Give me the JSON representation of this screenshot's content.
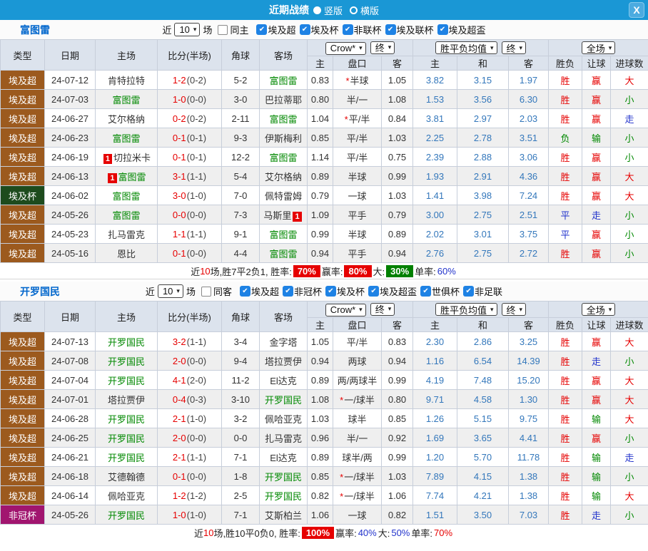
{
  "title_bar": {
    "title": "近期战绩",
    "radio_vertical": "竖版",
    "radio_horizontal": "横版",
    "close_label": "X"
  },
  "filter": {
    "near": "近",
    "count": "10",
    "games": "场"
  },
  "header": {
    "type": "类型",
    "date": "日期",
    "home": "主场",
    "score": "比分(半场)",
    "corner": "角球",
    "away": "客场",
    "odds_company": "Crow*",
    "odds_time": "终",
    "mean_type": "胜平负均值",
    "mean_time": "终",
    "scope": "全场",
    "sub_home": "主",
    "sub_handicap": "盘口",
    "sub_away": "客",
    "sub_mean_home": "主",
    "sub_mean_draw": "和",
    "sub_mean_away": "客",
    "sub_result": "胜负",
    "sub_let": "让球",
    "sub_goals": "进球数"
  },
  "colors": {
    "titlebar_blue": "#1A97D5",
    "team_green": "#008800",
    "mean_blue": "#3377BB",
    "type_bg": {
      "埃及超": "#9C5A1E",
      "埃及杯": "#1D4B1D",
      "非冠杯": "#A1156F"
    },
    "result": {
      "胜": "#E60000",
      "赢": "#E60000",
      "大": "#E60000",
      "平": "#2233CC",
      "走": "#2233CC",
      "负": "#008800",
      "输": "#008800",
      "小": "#008800"
    }
  },
  "sections": [
    {
      "team": "富图雷",
      "same_label": "同主",
      "leagues": [
        "埃及超",
        "埃及杯",
        "非联杯",
        "埃及联杯",
        "埃及超盃"
      ],
      "rows": [
        {
          "type": "埃及超",
          "date": "24-07-12",
          "home": "肯特拉特",
          "home_green": false,
          "score": "1-2",
          "half": "(0-2)",
          "corner": "5-2",
          "away": "富图雷",
          "away_green": true,
          "home_odds": "0.83",
          "star": true,
          "handicap": "半球",
          "away_odds": "1.05",
          "mean_home": "3.82",
          "mean_draw": "3.15",
          "mean_away": "1.97",
          "outcome": "胜",
          "let_outcome": "赢",
          "goals_outcome": "大"
        },
        {
          "type": "埃及超",
          "date": "24-07-03",
          "home": "富图雷",
          "home_green": true,
          "score": "1-0",
          "half": "(0-0)",
          "corner": "3-0",
          "away": "巴拉蒂耶",
          "away_green": false,
          "home_odds": "0.80",
          "star": false,
          "handicap": "半/一",
          "away_odds": "1.08",
          "mean_home": "1.53",
          "mean_draw": "3.56",
          "mean_away": "6.30",
          "outcome": "胜",
          "let_outcome": "赢",
          "goals_outcome": "小"
        },
        {
          "type": "埃及超",
          "date": "24-06-27",
          "home": "艾尔格纳",
          "home_green": false,
          "score": "0-2",
          "half": "(0-2)",
          "corner": "2-11",
          "away": "富图雷",
          "away_green": true,
          "home_odds": "1.04",
          "star": true,
          "handicap": "平/半",
          "away_odds": "0.84",
          "mean_home": "3.81",
          "mean_draw": "2.97",
          "mean_away": "2.03",
          "outcome": "胜",
          "let_outcome": "赢",
          "goals_outcome": "走"
        },
        {
          "type": "埃及超",
          "date": "24-06-23",
          "home": "富图雷",
          "home_green": true,
          "score": "0-1",
          "half": "(0-1)",
          "corner": "9-3",
          "away": "伊斯梅利",
          "away_green": false,
          "home_odds": "0.85",
          "star": false,
          "handicap": "平/半",
          "away_odds": "1.03",
          "mean_home": "2.25",
          "mean_draw": "2.78",
          "mean_away": "3.51",
          "outcome": "负",
          "let_outcome": "输",
          "goals_outcome": "小"
        },
        {
          "type": "埃及超",
          "date": "24-06-19",
          "home": "切拉米卡",
          "home_green": false,
          "home_badge": "1",
          "score": "0-1",
          "half": "(0-1)",
          "corner": "12-2",
          "away": "富图雷",
          "away_green": true,
          "home_odds": "1.14",
          "star": false,
          "handicap": "平/半",
          "away_odds": "0.75",
          "mean_home": "2.39",
          "mean_draw": "2.88",
          "mean_away": "3.06",
          "outcome": "胜",
          "let_outcome": "赢",
          "goals_outcome": "小"
        },
        {
          "type": "埃及超",
          "date": "24-06-13",
          "home": "富图雷",
          "home_green": true,
          "home_badge": "1",
          "score": "3-1",
          "half": "(1-1)",
          "corner": "5-4",
          "away": "艾尔格纳",
          "away_green": false,
          "home_odds": "0.89",
          "star": false,
          "handicap": "半球",
          "away_odds": "0.99",
          "mean_home": "1.93",
          "mean_draw": "2.91",
          "mean_away": "4.36",
          "outcome": "胜",
          "let_outcome": "赢",
          "goals_outcome": "大"
        },
        {
          "type": "埃及杯",
          "date": "24-06-02",
          "home": "富图雷",
          "home_green": true,
          "score": "3-0",
          "half": "(1-0)",
          "corner": "7-0",
          "away": "佩特雷姆",
          "away_green": false,
          "home_odds": "0.79",
          "star": false,
          "handicap": "一球",
          "away_odds": "1.03",
          "mean_home": "1.41",
          "mean_draw": "3.98",
          "mean_away": "7.24",
          "outcome": "胜",
          "let_outcome": "赢",
          "goals_outcome": "大"
        },
        {
          "type": "埃及超",
          "date": "24-05-26",
          "home": "富图雷",
          "home_green": true,
          "score": "0-0",
          "half": "(0-0)",
          "corner": "7-3",
          "away": "马斯里",
          "away_green": false,
          "away_badge": "1",
          "away_badge_after": true,
          "home_odds": "1.09",
          "star": false,
          "handicap": "平手",
          "away_odds": "0.79",
          "mean_home": "3.00",
          "mean_draw": "2.75",
          "mean_away": "2.51",
          "outcome": "平",
          "let_outcome": "走",
          "goals_outcome": "小"
        },
        {
          "type": "埃及超",
          "date": "24-05-23",
          "home": "扎马雷克",
          "home_green": false,
          "score": "1-1",
          "half": "(1-1)",
          "corner": "9-1",
          "away": "富图雷",
          "away_green": true,
          "home_odds": "0.99",
          "star": false,
          "handicap": "半球",
          "away_odds": "0.89",
          "mean_home": "2.02",
          "mean_draw": "3.01",
          "mean_away": "3.75",
          "outcome": "平",
          "let_outcome": "赢",
          "goals_outcome": "小"
        },
        {
          "type": "埃及超",
          "date": "24-05-16",
          "home": "恩比",
          "home_green": false,
          "score": "0-1",
          "half": "(0-0)",
          "corner": "4-4",
          "away": "富图雷",
          "away_green": true,
          "home_odds": "0.94",
          "star": false,
          "handicap": "平手",
          "away_odds": "0.94",
          "mean_home": "2.76",
          "mean_draw": "2.75",
          "mean_away": "2.72",
          "outcome": "胜",
          "let_outcome": "赢",
          "goals_outcome": "小"
        }
      ],
      "summary": {
        "near": "近",
        "count": "10",
        "text": "场,胜7平2负1, 胜率:",
        "win_rate": "70%",
        "win_class": "pct badge-red",
        "handicap_label": "赢率:",
        "handicap_rate": "80%",
        "handicap_class": "pct badge-red",
        "big_label": "大:",
        "big_rate": "30%",
        "big_class": "pct badge-green",
        "single_label": "单率:",
        "single_rate": "60%",
        "single_class": "pct text-blue"
      }
    },
    {
      "team": "开罗国民",
      "same_label": "同客",
      "leagues": [
        "埃及超",
        "非冠杯",
        "埃及杯",
        "埃及超盃",
        "世俱杯",
        "非足联"
      ],
      "rows": [
        {
          "type": "埃及超",
          "date": "24-07-13",
          "home": "开罗国民",
          "home_green": true,
          "score": "3-2",
          "half": "(1-1)",
          "corner": "3-4",
          "away": "金字塔",
          "away_green": false,
          "home_odds": "1.05",
          "star": false,
          "handicap": "平/半",
          "away_odds": "0.83",
          "mean_home": "2.30",
          "mean_draw": "2.86",
          "mean_away": "3.25",
          "outcome": "胜",
          "let_outcome": "赢",
          "goals_outcome": "大"
        },
        {
          "type": "埃及超",
          "date": "24-07-08",
          "home": "开罗国民",
          "home_green": true,
          "score": "2-0",
          "half": "(0-0)",
          "corner": "9-4",
          "away": "塔拉贾伊",
          "away_green": false,
          "home_odds": "0.94",
          "star": false,
          "handicap": "两球",
          "away_odds": "0.94",
          "mean_home": "1.16",
          "mean_draw": "6.54",
          "mean_away": "14.39",
          "outcome": "胜",
          "let_outcome": "走",
          "goals_outcome": "小"
        },
        {
          "type": "埃及超",
          "date": "24-07-04",
          "home": "开罗国民",
          "home_green": true,
          "score": "4-1",
          "half": "(2-0)",
          "corner": "11-2",
          "away": "El达克",
          "away_green": false,
          "home_odds": "0.89",
          "star": false,
          "handicap": "两/两球半",
          "away_odds": "0.99",
          "mean_home": "4.19",
          "mean_draw": "7.48",
          "mean_away": "15.20",
          "outcome": "胜",
          "let_outcome": "赢",
          "goals_outcome": "大"
        },
        {
          "type": "埃及超",
          "date": "24-07-01",
          "home": "塔拉贾伊",
          "home_green": false,
          "score": "0-4",
          "half": "(0-3)",
          "corner": "3-10",
          "away": "开罗国民",
          "away_green": true,
          "home_odds": "1.08",
          "star": true,
          "handicap": "一/球半",
          "away_odds": "0.80",
          "mean_home": "9.71",
          "mean_draw": "4.58",
          "mean_away": "1.30",
          "outcome": "胜",
          "let_outcome": "赢",
          "goals_outcome": "大"
        },
        {
          "type": "埃及超",
          "date": "24-06-28",
          "home": "开罗国民",
          "home_green": true,
          "score": "2-1",
          "half": "(1-0)",
          "corner": "3-2",
          "away": "佩哈亚克",
          "away_green": false,
          "home_odds": "1.03",
          "star": false,
          "handicap": "球半",
          "away_odds": "0.85",
          "mean_home": "1.26",
          "mean_draw": "5.15",
          "mean_away": "9.75",
          "outcome": "胜",
          "let_outcome": "输",
          "goals_outcome": "大"
        },
        {
          "type": "埃及超",
          "date": "24-06-25",
          "home": "开罗国民",
          "home_green": true,
          "score": "2-0",
          "half": "(0-0)",
          "corner": "0-0",
          "away": "扎马雷克",
          "away_green": false,
          "home_odds": "0.96",
          "star": false,
          "handicap": "半/一",
          "away_odds": "0.92",
          "mean_home": "1.69",
          "mean_draw": "3.65",
          "mean_away": "4.41",
          "outcome": "胜",
          "let_outcome": "赢",
          "goals_outcome": "小"
        },
        {
          "type": "埃及超",
          "date": "24-06-21",
          "home": "开罗国民",
          "home_green": true,
          "score": "2-1",
          "half": "(1-1)",
          "corner": "7-1",
          "away": "El达克",
          "away_green": false,
          "home_odds": "0.89",
          "star": false,
          "handicap": "球半/两",
          "away_odds": "0.99",
          "mean_home": "1.20",
          "mean_draw": "5.70",
          "mean_away": "11.78",
          "outcome": "胜",
          "let_outcome": "输",
          "goals_outcome": "走"
        },
        {
          "type": "埃及超",
          "date": "24-06-18",
          "home": "艾德翰德",
          "home_green": false,
          "score": "0-1",
          "half": "(0-0)",
          "corner": "1-8",
          "away": "开罗国民",
          "away_green": true,
          "home_odds": "0.85",
          "star": true,
          "handicap": "一/球半",
          "away_odds": "1.03",
          "mean_home": "7.89",
          "mean_draw": "4.15",
          "mean_away": "1.38",
          "outcome": "胜",
          "let_outcome": "输",
          "goals_outcome": "小"
        },
        {
          "type": "埃及超",
          "date": "24-06-14",
          "home": "佩哈亚克",
          "home_green": false,
          "score": "1-2",
          "half": "(1-2)",
          "corner": "2-5",
          "away": "开罗国民",
          "away_green": true,
          "home_odds": "0.82",
          "star": true,
          "handicap": "一/球半",
          "away_odds": "1.06",
          "mean_home": "7.74",
          "mean_draw": "4.21",
          "mean_away": "1.38",
          "outcome": "胜",
          "let_outcome": "输",
          "goals_outcome": "大"
        },
        {
          "type": "非冠杯",
          "date": "24-05-26",
          "home": "开罗国民",
          "home_green": true,
          "score": "1-0",
          "half": "(1-0)",
          "corner": "7-1",
          "away": "艾斯柏兰",
          "away_green": false,
          "home_odds": "1.06",
          "star": false,
          "handicap": "一球",
          "away_odds": "0.82",
          "mean_home": "1.51",
          "mean_draw": "3.50",
          "mean_away": "7.03",
          "outcome": "胜",
          "let_outcome": "走",
          "goals_outcome": "小"
        }
      ],
      "summary": {
        "near": "近",
        "count": "10",
        "text": "场,胜10平0负0, 胜率:",
        "win_rate": "100%",
        "win_class": "pct badge-red",
        "handicap_label": "赢率:",
        "handicap_rate": "40%",
        "handicap_class": "pct text-blue",
        "big_label": "大:",
        "big_rate": "50%",
        "big_class": "pct text-blue",
        "single_label": "单率:",
        "single_rate": "70%",
        "single_class": "pct text-red"
      }
    }
  ]
}
